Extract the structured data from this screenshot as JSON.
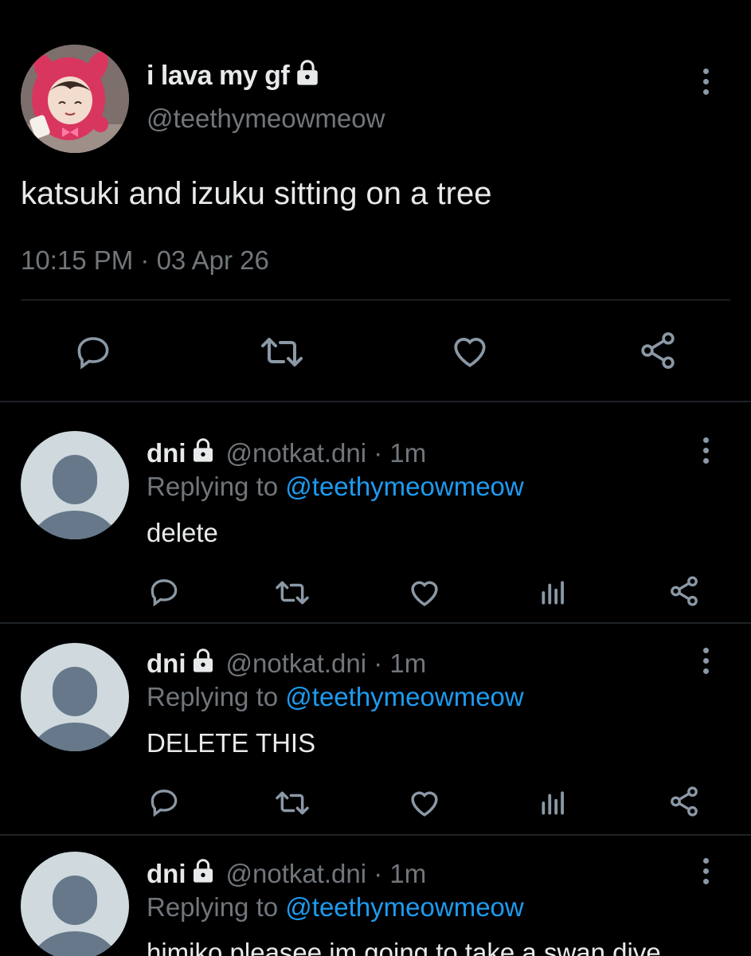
{
  "main_tweet": {
    "display_name": "i lava my gf",
    "handle": "@teethymeowmeow",
    "text": "katsuki and izuku sitting on a tree",
    "timestamp": "10:15 PM · 03 Apr 26"
  },
  "replies": [
    {
      "display_name": "dni",
      "handle": "@notkat.dni · 1m",
      "replying_label": "Replying to",
      "replying_to": "@teethymeowmeow",
      "text": "delete"
    },
    {
      "display_name": "dni",
      "handle": "@notkat.dni · 1m",
      "replying_label": "Replying to",
      "replying_to": "@teethymeowmeow",
      "text": "DELETE THIS"
    },
    {
      "display_name": "dni",
      "handle": "@notkat.dni · 1m",
      "replying_label": "Replying to",
      "replying_to": "@teethymeowmeow",
      "text": "himiko pleasee im going to take a swan dive"
    }
  ],
  "icons": {
    "reply": "reply-icon",
    "retweet": "retweet-icon",
    "like": "heart-icon",
    "views": "views-icon",
    "share": "share-icon",
    "lock": "lock-icon",
    "more": "more-vertical-icon"
  },
  "colors": {
    "background": "#000000",
    "text_primary": "#e7e9ea",
    "text_secondary": "#71767b",
    "mention": "#1d9bf0",
    "icon": "#8b98a5",
    "divider": "#2f3336",
    "default_avatar_bg": "#cfd9de",
    "default_avatar_fg": "#66788a"
  }
}
